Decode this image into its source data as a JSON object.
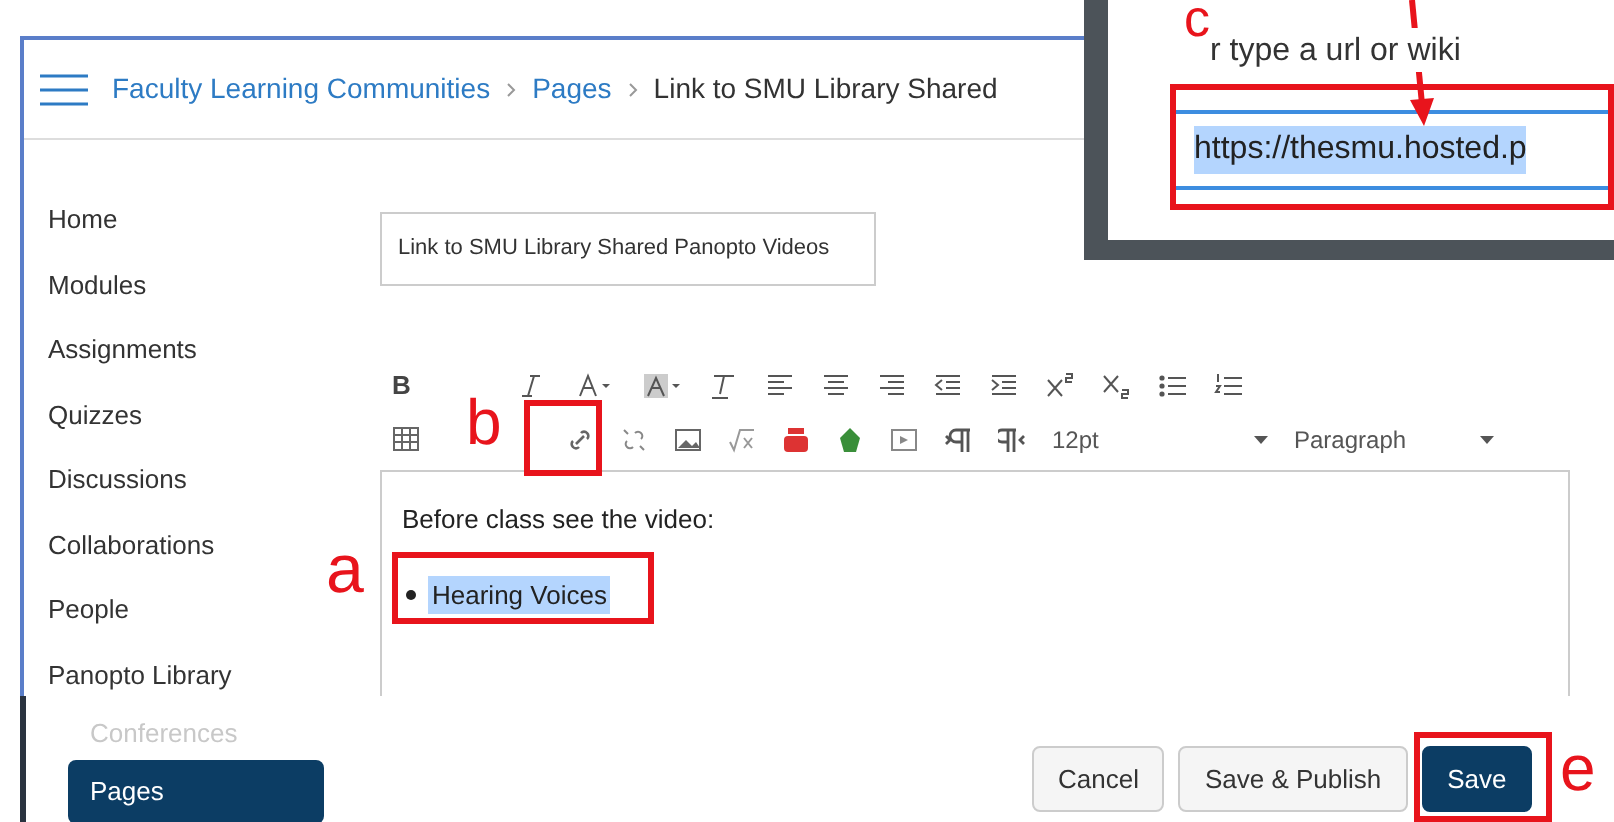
{
  "breadcrumb": [
    {
      "label": "Faculty Learning Communities",
      "link": true
    },
    {
      "label": "Pages",
      "link": true
    },
    {
      "label": "Link to SMU Library Shared",
      "link": false
    }
  ],
  "sidebar": {
    "items": [
      {
        "label": "Home",
        "selected": false,
        "faded": false
      },
      {
        "label": "Modules",
        "selected": false,
        "faded": false
      },
      {
        "label": "Assignments",
        "selected": false,
        "faded": false
      },
      {
        "label": "Quizzes",
        "selected": false,
        "faded": false
      },
      {
        "label": "Discussions",
        "selected": false,
        "faded": false
      },
      {
        "label": "Collaborations",
        "selected": false,
        "faded": false
      },
      {
        "label": "People",
        "selected": false,
        "faded": false
      },
      {
        "label": "Panopto Library",
        "selected": false,
        "faded": false
      },
      {
        "label": "Conferences",
        "selected": false,
        "faded": true
      },
      {
        "label": "Pages",
        "selected": true,
        "faded": false
      }
    ]
  },
  "page_title": {
    "value": "Link to SMU Library Shared Panopto Videos"
  },
  "toolbar": {
    "bold": "B",
    "font_size": "12pt",
    "block_format": "Paragraph"
  },
  "editor": {
    "paragraph": "Before class see the video:",
    "bullets": [
      {
        "text": "Hearing Voices",
        "selected": true
      }
    ]
  },
  "buttons": [
    {
      "label": "Cancel",
      "primary": false
    },
    {
      "label": "Save & Publish",
      "primary": false
    },
    {
      "label": "Save",
      "primary": true
    }
  ],
  "link_dialog": {
    "hint": "r type a url or wiki",
    "url": "https://thesmu.hosted.p"
  },
  "annotations": [
    "a",
    "b",
    "c",
    "e"
  ]
}
